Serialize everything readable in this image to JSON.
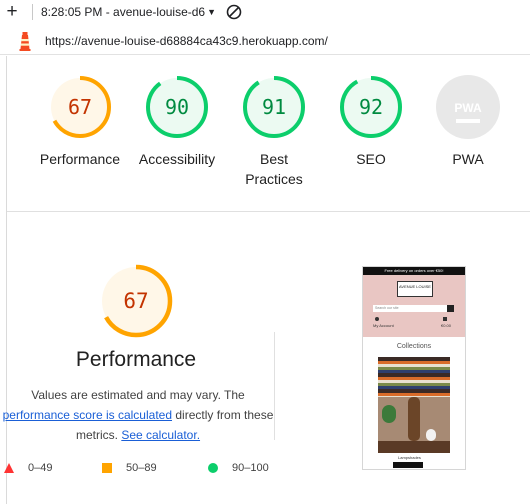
{
  "toolbar": {
    "run_time": "8:28:05 PM - avenue-louise-d6",
    "new_icon": "plus-icon",
    "block_icon": "block-icon"
  },
  "report": {
    "url": "https://avenue-louise-d68884ca43c9.herokuapp.com/"
  },
  "colors": {
    "fail": "#ff3333",
    "average": "#ffa400",
    "pass": "#0cce6b",
    "pwa": "#c8c8c8"
  },
  "categories": [
    {
      "label": "Performance",
      "score": "67",
      "value": 0.67,
      "rating": "average"
    },
    {
      "label": "Accessibility",
      "score": "90",
      "value": 0.9,
      "rating": "pass"
    },
    {
      "label": "Best Practices",
      "score": "91",
      "value": 0.91,
      "rating": "pass"
    },
    {
      "label": "SEO",
      "score": "92",
      "value": 0.92,
      "rating": "pass"
    },
    {
      "label": "PWA",
      "score": "",
      "value": 0,
      "rating": "pwa"
    }
  ],
  "pwa_badge": "PWA",
  "performance": {
    "score": "67",
    "value": 0.67,
    "title": "Performance",
    "desc_1": "Values are estimated and may vary. The",
    "desc_link_1": "performance score is calculated",
    "desc_2": "directly from these",
    "desc_3": "metrics.",
    "desc_link_2": "See calculator."
  },
  "legend": [
    {
      "range": "0–49",
      "rating": "fail"
    },
    {
      "range": "50–89",
      "rating": "average"
    },
    {
      "range": "90–100",
      "rating": "pass"
    }
  ],
  "screenshot": {
    "promo": "Free delivery on orders over €50!",
    "logo": "AVENUE LOUISE",
    "search_placeholder": "Search our site",
    "account": "My Account",
    "total": "€0.00",
    "collections": "Collections",
    "caption": "Lampshades"
  }
}
